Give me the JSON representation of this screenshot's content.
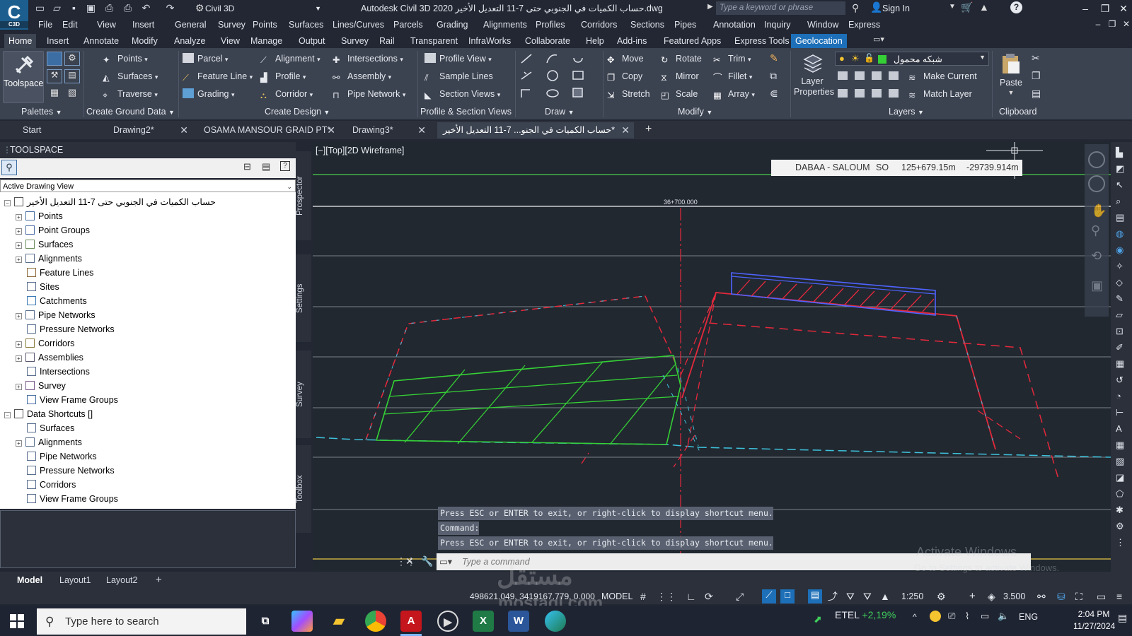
{
  "app": {
    "logo_text": "C",
    "logo_sub": "C3D",
    "workspace": "Civil 3D",
    "title": "Autodesk Civil 3D 2020  حساب الكميات في الجنوبي حتى 7-11 التعديل الأخير.dwg",
    "search_placeholder": "Type a keyword or phrase",
    "signin": "Sign In"
  },
  "menu": [
    "File",
    "Edit",
    "View",
    "Insert",
    "General",
    "Survey",
    "Points",
    "Surfaces",
    "Lines/Curves",
    "Parcels",
    "Grading",
    "Alignments",
    "Profiles",
    "Corridors",
    "Sections",
    "Pipes",
    "Annotation",
    "Inquiry",
    "Window",
    "Express"
  ],
  "ribbon_tabs": [
    "Home",
    "Insert",
    "Annotate",
    "Modify",
    "Analyze",
    "View",
    "Manage",
    "Output",
    "Survey",
    "Rail",
    "Transparent",
    "InfraWorks",
    "Collaborate",
    "Help",
    "Add-ins",
    "Featured Apps",
    "Express Tools",
    "Geolocation"
  ],
  "ribbon": {
    "toolspace": "Toolspace",
    "palettes": "Palettes",
    "ground": {
      "points": "Points",
      "surfaces": "Surfaces",
      "traverse": "Traverse",
      "title": "Create Ground Data"
    },
    "design": {
      "parcel": "Parcel",
      "feature_line": "Feature Line",
      "grading": "Grading",
      "alignment": "Alignment",
      "profile": "Profile",
      "corridor": "Corridor",
      "intersections": "Intersections",
      "assembly": "Assembly",
      "pipe_network": "Pipe Network",
      "title": "Create Design"
    },
    "pv": {
      "profile_view": "Profile View",
      "sample_lines": "Sample Lines",
      "section_views": "Section Views",
      "title": "Profile & Section Views"
    },
    "draw_title": "Draw",
    "modify": {
      "move": "Move",
      "rotate": "Rotate",
      "trim": "Trim",
      "copy": "Copy",
      "mirror": "Mirror",
      "fillet": "Fillet",
      "stretch": "Stretch",
      "scale": "Scale",
      "array": "Array",
      "title": "Modify"
    },
    "layers": {
      "layer_properties": "Layer Properties",
      "current_layer": "شبكه محمول",
      "make_current": "Make Current",
      "match_layer": "Match Layer",
      "title": "Layers"
    },
    "clipboard": {
      "paste": "Paste",
      "title": "Clipboard"
    }
  },
  "doc_tabs": [
    "Start",
    "Drawing2*",
    "OSAMA MANSOUR GRAID PT*",
    "Drawing3*",
    "حساب الكميات في الجنو... 7-11 التعديل الأخير*"
  ],
  "toolspace": {
    "header": "TOOLSPACE",
    "view_select": "Active Drawing View",
    "root": "حساب الكميات في الجنوبي حتى 7-11 التعديل الأخير",
    "items": [
      "Points",
      "Point Groups",
      "Surfaces",
      "Alignments",
      "Feature Lines",
      "Sites",
      "Catchments",
      "Pipe Networks",
      "Pressure Networks",
      "Corridors",
      "Assemblies",
      "Intersections",
      "Survey",
      "View Frame Groups"
    ],
    "shortcuts_root": "Data Shortcuts []",
    "shortcut_items": [
      "Surfaces",
      "Alignments",
      "Pipe Networks",
      "Pressure Networks",
      "Corridors",
      "View Frame Groups"
    ],
    "side_tabs": [
      "Prospector",
      "Settings",
      "Survey",
      "Toolbox"
    ]
  },
  "viewport": {
    "label": "[−][Top][2D Wireframe]",
    "info_name": "DABAA - SALOUM",
    "info_side": "SO",
    "info_station": "125+679.15m",
    "info_offset": "-29739.914m",
    "station_label": "36+700.000"
  },
  "command": {
    "history": [
      "Press ESC or ENTER to exit, or right-click to display shortcut menu.",
      "Command:",
      "Press ESC or ENTER to exit, or right-click to display shortcut menu."
    ],
    "placeholder": "Type a command"
  },
  "layout_tabs": [
    "Model",
    "Layout1",
    "Layout2"
  ],
  "status": {
    "coords": "498621.049, 3419167.779, 0.000",
    "model": "MODEL",
    "scale": "1:250",
    "lineweight": "3.500"
  },
  "taskbar": {
    "search": "Type here to search",
    "network": "ETEL",
    "network_change": "+2,19%",
    "lang": "ENG",
    "time": "2:04 PM",
    "date": "11/27/2024"
  },
  "watermark": {
    "activate": "Activate Windows",
    "activate_sub": "Go to Settings to activate Windows.",
    "site_ar": "مستقل",
    "site": "mostaql.com"
  },
  "colors": {
    "accent": "#1d6fb8",
    "canvas": "#212830",
    "ribbon": "#3b4250",
    "green_line": "#35d035",
    "red_line": "#e5283c",
    "cyan_line": "#3fc2dc",
    "blue_line": "#4f63ff"
  }
}
